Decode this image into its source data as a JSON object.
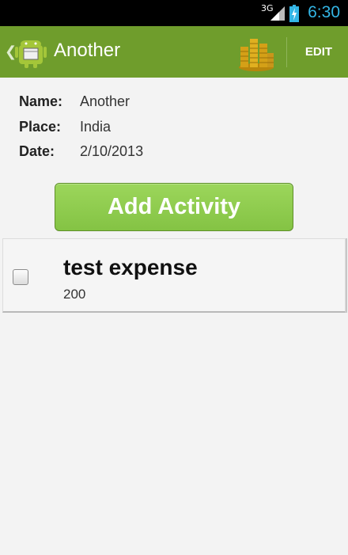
{
  "status_bar": {
    "network": "3G",
    "time": "6:30"
  },
  "action_bar": {
    "title": "Another",
    "edit_label": "EDIT",
    "icons": [
      "android-app-icon",
      "coins-icon"
    ]
  },
  "details": {
    "name_label": "Name:",
    "name_value": "Another",
    "place_label": "Place:",
    "place_value": "India",
    "date_label": "Date:",
    "date_value": "2/10/2013"
  },
  "add_activity_label": "Add Activity",
  "activities": [
    {
      "name": "test expense",
      "amount": "200",
      "checked": false
    }
  ],
  "colors": {
    "action_bar": "#6f9d2c",
    "button": "#8bc94a",
    "status_time": "#33b5e5",
    "background": "#f3f3f3"
  }
}
